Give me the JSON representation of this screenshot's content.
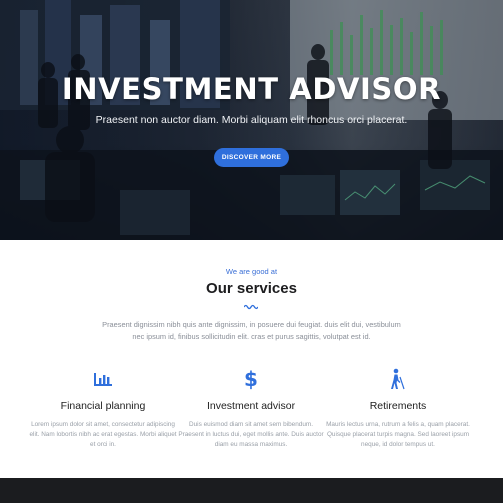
{
  "hero": {
    "title": "INVESTMENT ADVISOR",
    "subtitle": "Praesent non auctor diam. Morbi aliquam elit rhoncus orci placerat.",
    "cta_label": "DISCOVER MORE"
  },
  "services": {
    "eyebrow": "We are good at",
    "title": "Our services",
    "intro": "Praesent dignissim nibh quis ante dignissim, in posuere dui feugiat. duis elit dui, vestibulum nec ipsum id, finibus sollicitudin elit. cras et purus sagittis, volutpat est id.",
    "items": [
      {
        "icon": "bar-chart-icon",
        "title": "Financial planning",
        "text": "Lorem ipsum dolor sit amet, consectetur adipiscing elit. Nam lobortis nibh ac erat egestas. Morbi aliquet et orci in."
      },
      {
        "icon": "dollar-icon",
        "title": "Investment advisor",
        "text": "Duis euismod diam sit amet sem bibendum. Praesent in luctus dui, eget mollis ante. Duis auctor diam eu massa maximus."
      },
      {
        "icon": "person-walking-cane-icon",
        "title": "Retirements",
        "text": "Mauris lectus urna, rutrum a felis a, quam placerat. Quisque placerat turpis magna. Sed laoreet ipsum neque, id dolor tempus ut."
      }
    ]
  },
  "colors": {
    "accent": "#2f6fdc",
    "heading": "#1d1d1f",
    "muted_text": "#8a8f98",
    "footer": "#1b1c1f"
  }
}
